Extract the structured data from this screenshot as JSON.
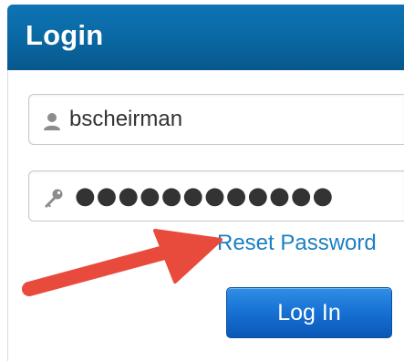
{
  "header": {
    "title": "Login"
  },
  "form": {
    "username_value": "bscheirman",
    "password_masked": "●●●●●●●●●●●●",
    "reset_link_label": "Reset Password",
    "login_button_label": "Log In"
  },
  "icons": {
    "username": "user-icon",
    "password": "key-icon",
    "annotation": "red-arrow-icon"
  },
  "colors": {
    "header_bg": "#0a6aa6",
    "link": "#1b7fc4",
    "button_bg": "#1670d3",
    "arrow": "#e84a3c"
  }
}
